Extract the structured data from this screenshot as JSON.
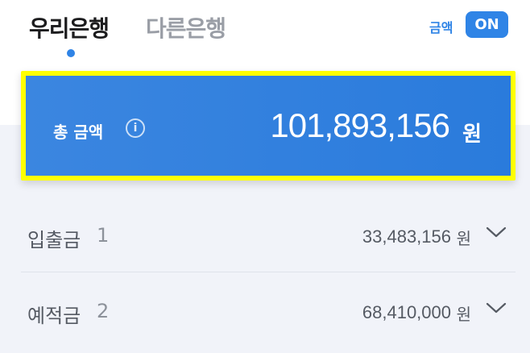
{
  "tabs": [
    {
      "label": "우리은행",
      "active": true
    },
    {
      "label": "다른은행",
      "active": false
    }
  ],
  "amount_toggle": {
    "label": "금액",
    "state": "ON"
  },
  "total": {
    "label": "총 금액",
    "info_icon": "info-icon",
    "amount": "101,893,156",
    "unit": "원"
  },
  "accounts": [
    {
      "name": "입출금",
      "count": "1",
      "amount": "33,483,156",
      "unit": "원",
      "icon": "chevron-down-icon"
    },
    {
      "name": "예적금",
      "count": "2",
      "amount": "68,410,000",
      "unit": "원",
      "icon": "chevron-down-icon"
    }
  ],
  "colors": {
    "accent": "#2f84e6",
    "highlight": "#ffff00",
    "background": "#f1f3f9"
  }
}
